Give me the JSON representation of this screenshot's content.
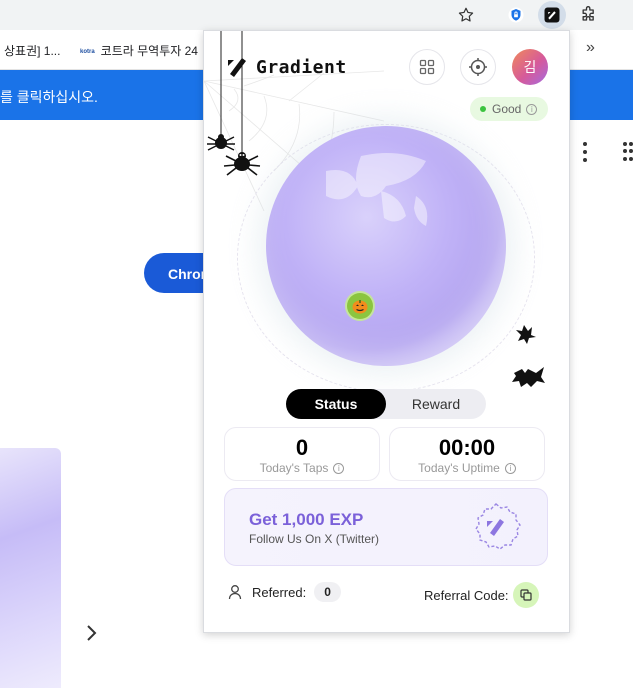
{
  "browser": {
    "bookmarks": [
      {
        "label": "상표권] 1..."
      },
      {
        "icon_text": "kotra",
        "label": "코트라 무역투자 24"
      }
    ],
    "more_label": "»",
    "banner_text": "를 클릭하십시오.",
    "page_button_label": "Chror"
  },
  "popup": {
    "logo_text": "Gradient",
    "avatar_text": "김",
    "status_pill": {
      "label": "Good",
      "color": "#3cc33f"
    },
    "tabs": [
      {
        "label": "Status",
        "active": true
      },
      {
        "label": "Reward",
        "active": false
      }
    ],
    "stats": [
      {
        "value": "0",
        "label": "Today's Taps"
      },
      {
        "value": "00:00",
        "label": "Today's Uptime"
      }
    ],
    "exp_card": {
      "title": "Get 1,000 EXP",
      "subtitle": "Follow Us On X (Twitter)"
    },
    "referral": {
      "referred_label": "Referred:",
      "referred_count": "0",
      "code_label": "Referral Code:"
    },
    "accent_color": "#7b61d9",
    "icons": [
      "apps-icon",
      "target-icon",
      "info-icon",
      "pumpkin-icon",
      "spider-icon",
      "bat-icon",
      "person-icon",
      "copy-icon",
      "gradient-badge-icon"
    ]
  }
}
